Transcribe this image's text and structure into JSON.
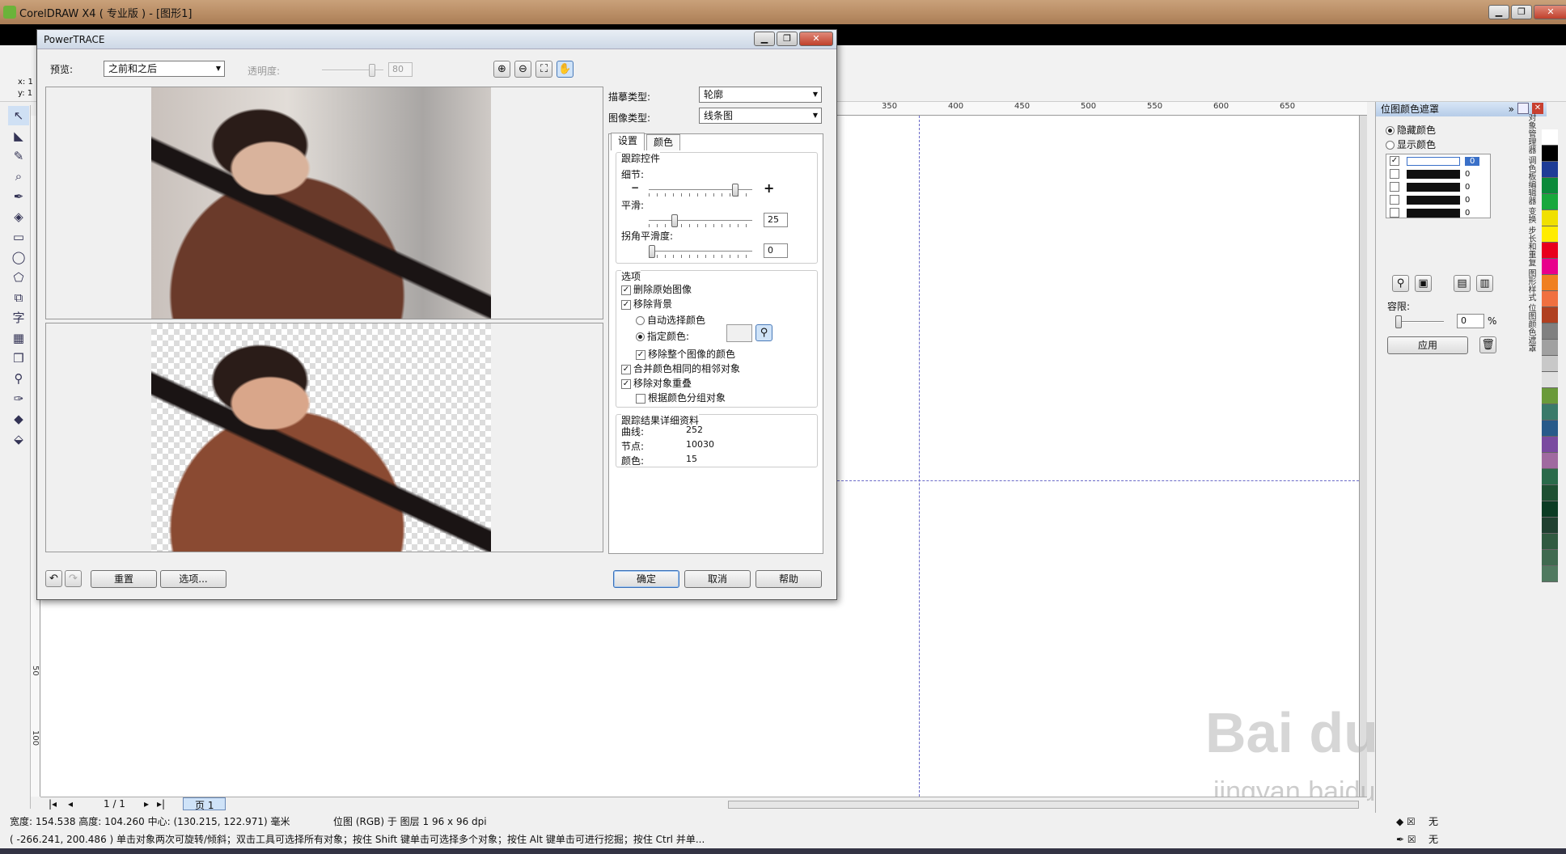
{
  "app": {
    "title": "CorelDRAW X4 ( 专业版 ) - [图形1]"
  },
  "ruler": {
    "top_ticks": [
      "350",
      "400",
      "450",
      "500",
      "550",
      "600",
      "650"
    ],
    "left_ticks": [
      "50",
      "100"
    ]
  },
  "dialog": {
    "title": "PowerTRACE",
    "preview_label": "预览:",
    "preview_value": "之前和之后",
    "transparency_label": "透明度:",
    "transparency_value": "80",
    "trace_type_label": "描摹类型:",
    "trace_type_value": "轮廓",
    "image_type_label": "图像类型:",
    "image_type_value": "线条图",
    "tabs": [
      "设置",
      "颜色"
    ],
    "trace_controls": {
      "title": "跟踪控件",
      "detail_label": "细节:",
      "detail_level": 0.86,
      "smoothing_label": "平滑:",
      "smoothing_value": "25",
      "corner_label": "拐角平滑度:",
      "corner_value": "0"
    },
    "options": {
      "title": "选项",
      "delete_original": "删除原始图像",
      "remove_background": "移除背景",
      "auto_select_color": "自动选择颜色",
      "specify_color": "指定颜色:",
      "remove_whole_image_color": "移除整个图像的颜色",
      "merge_adjacent": "合并颜色相同的相邻对象",
      "remove_overlap": "移除对象重叠",
      "group_by_color": "根据颜色分组对象"
    },
    "results": {
      "title": "跟踪结果详细资料",
      "curves_label": "曲线:",
      "curves_value": "252",
      "nodes_label": "节点:",
      "nodes_value": "10030",
      "colors_label": "颜色:",
      "colors_value": "15"
    },
    "buttons": {
      "reset": "重置",
      "options": "选项...",
      "ok": "确定",
      "cancel": "取消",
      "help": "帮助"
    }
  },
  "docker": {
    "title": "位图颜色遮罩",
    "hide_colors": "隐藏颜色",
    "show_colors": "显示颜色",
    "color_values": [
      "0",
      "0",
      "0",
      "0",
      "0"
    ],
    "tolerance_label": "容限:",
    "tolerance_value": "0",
    "tolerance_unit": "%",
    "apply": "应用",
    "side_tabs": [
      "对象管理器",
      "调色板编辑器",
      "变换",
      "步长和重复",
      "图形样式",
      "位图颜色遮罩"
    ]
  },
  "page_nav": {
    "counter": "1 / 1",
    "page_tab": "页 1"
  },
  "status": {
    "line1_size": "宽度: 154.538  高度: 104.260  中心: (130.215, 122.971)  毫米",
    "line1_layer": "位图 (RGB) 于 图层 1 96 x 96 dpi",
    "line2": "( -266.241, 200.486 )   单击对象两次可旋转/倾斜；双击工具可选择所有对象；按住 Shift 键单击可选择多个对象；按住 Alt 键单击可进行挖掘；按住 Ctrl 并单...",
    "fill_none": "无",
    "outline_none": "无"
  },
  "coords": {
    "x": "x: 1",
    "y": "y: 1"
  },
  "watermark": {
    "text": "Bai du 经验",
    "url": "jingyan.baidu.com"
  },
  "palette_colors": [
    "#ffffff",
    "#000000",
    "#1e3c96",
    "#0a8a3a",
    "#18a83c",
    "#f0e000",
    "#ffec00",
    "#e8001c",
    "#e8008c",
    "#f08020",
    "#f07040",
    "#b04020",
    "#808080",
    "#a0a0a0",
    "#c8c8c8",
    "#e0e0e0",
    "#6a9a3a",
    "#3a7a6a",
    "#285a8a",
    "#7a4aa0",
    "#a06aa0",
    "#2a6a4a",
    "#1e5032",
    "#0c3c24",
    "#204030",
    "#305a40",
    "#406a50",
    "#507a60"
  ]
}
